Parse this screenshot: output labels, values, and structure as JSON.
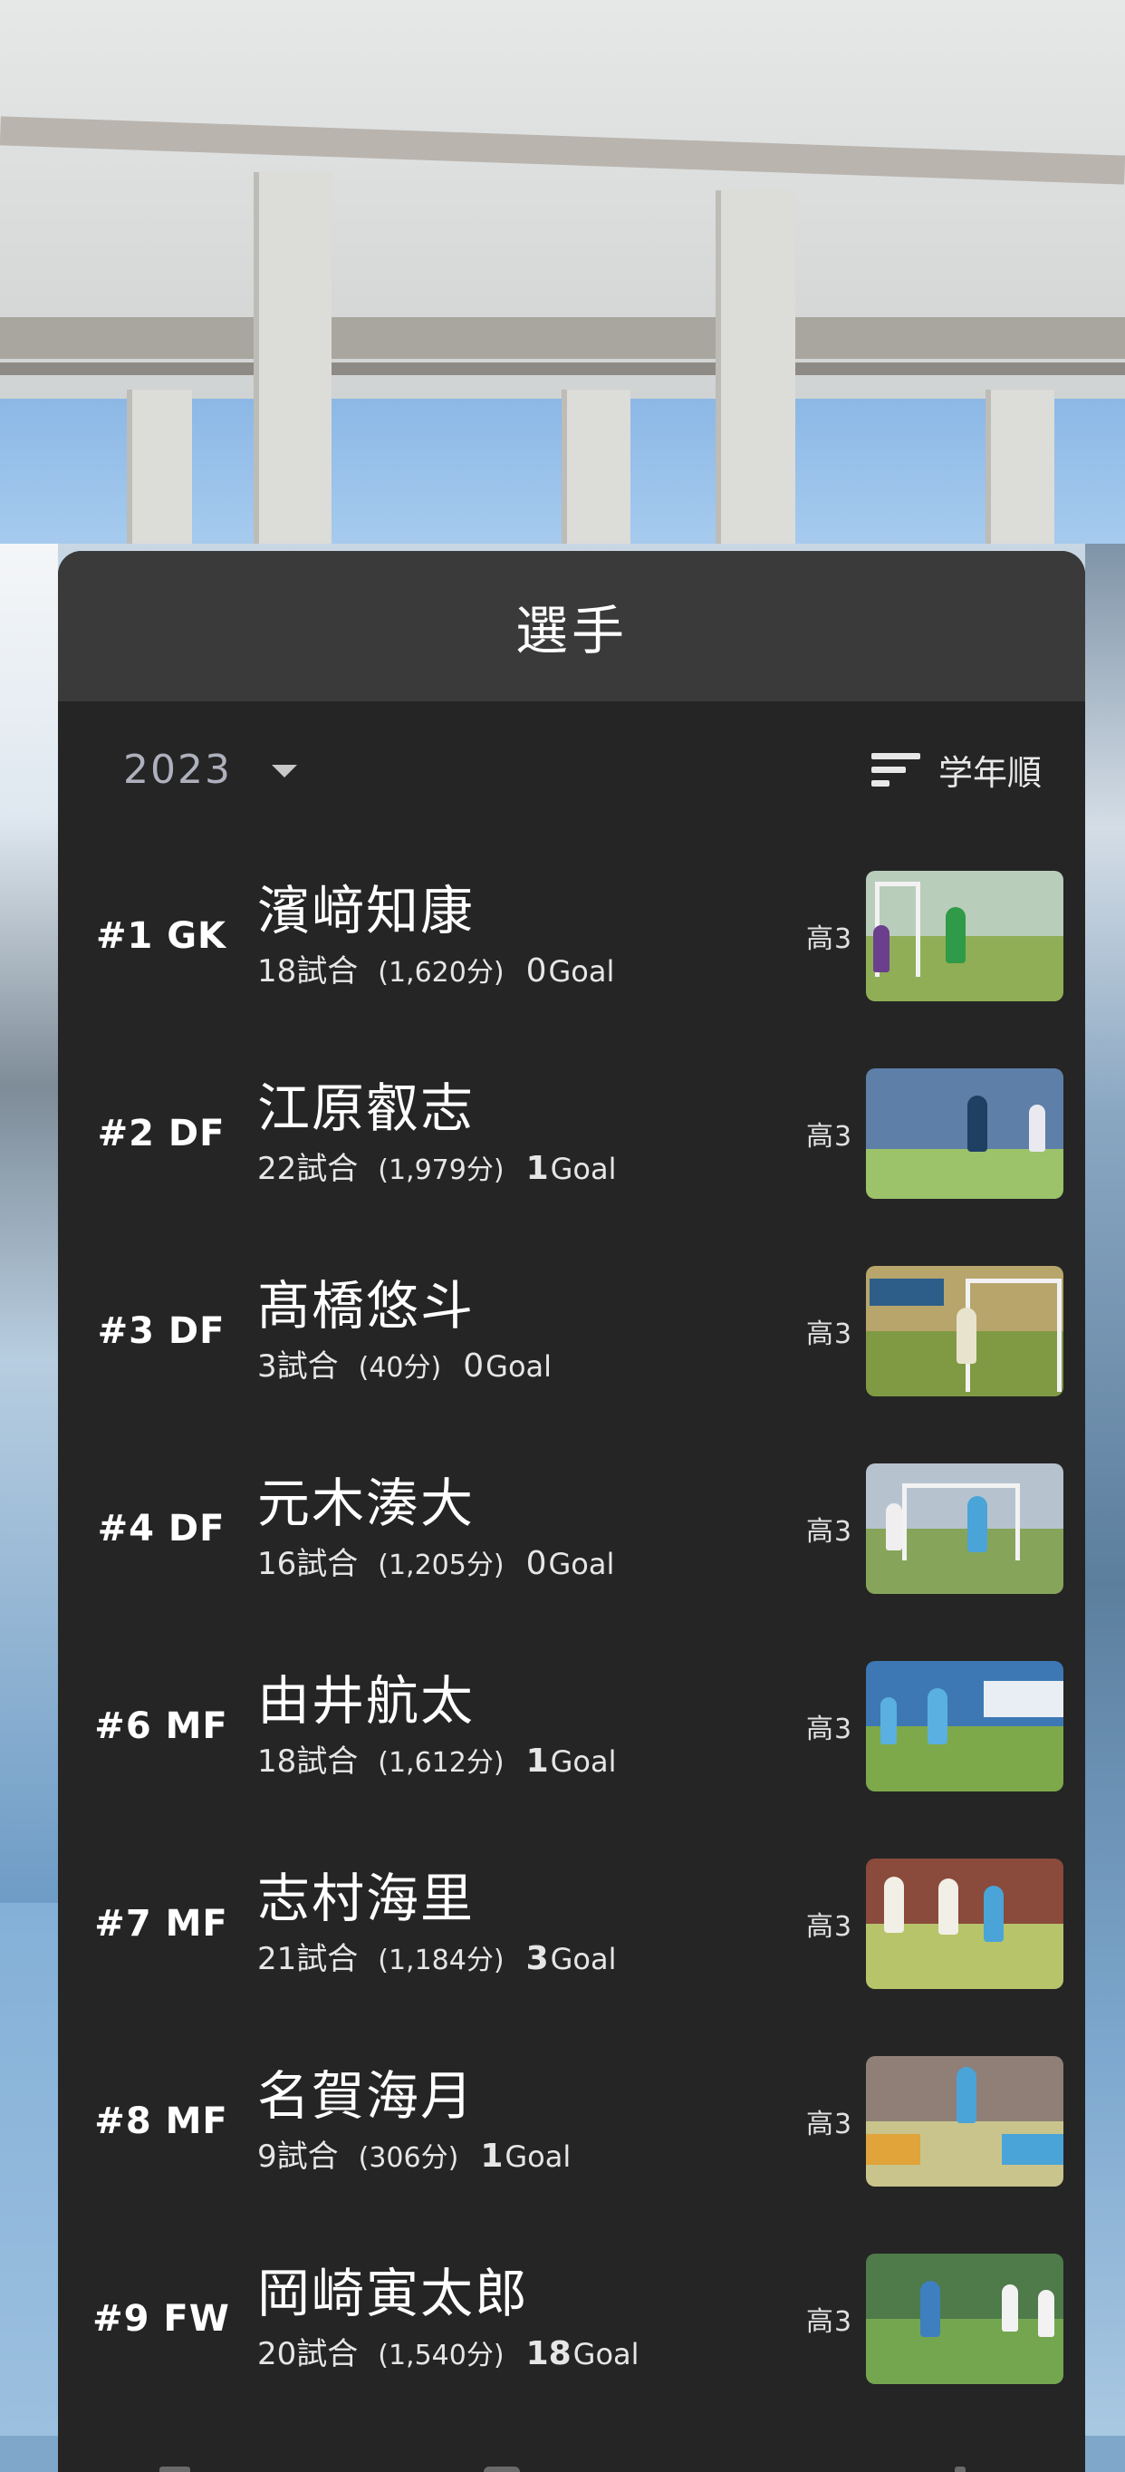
{
  "header": {
    "title": "選手"
  },
  "filter": {
    "year": "2023"
  },
  "sort": {
    "label": "学年順",
    "icon": "sort-icon"
  },
  "players": [
    {
      "number": "#1 GK",
      "name": "濱﨑知康",
      "games": "18試合",
      "minutes": "(1,620分)",
      "goals": "0",
      "goal_label": "Goal",
      "grade": "高3",
      "goals_bold": false
    },
    {
      "number": "#2 DF",
      "name": "江原叡志",
      "games": "22試合",
      "minutes": "(1,979分)",
      "goals": "1",
      "goal_label": "Goal",
      "grade": "高3",
      "goals_bold": true
    },
    {
      "number": "#3 DF",
      "name": "髙橋悠斗",
      "games": "3試合",
      "minutes": "(40分)",
      "goals": "0",
      "goal_label": "Goal",
      "grade": "高3",
      "goals_bold": false
    },
    {
      "number": "#4 DF",
      "name": "元木湊大",
      "games": "16試合",
      "minutes": "(1,205分)",
      "goals": "0",
      "goal_label": "Goal",
      "grade": "高3",
      "goals_bold": false
    },
    {
      "number": "#6 MF",
      "name": "由井航太",
      "games": "18試合",
      "minutes": "(1,612分)",
      "goals": "1",
      "goal_label": "Goal",
      "grade": "高3",
      "goals_bold": true
    },
    {
      "number": "#7 MF",
      "name": "志村海里",
      "games": "21試合",
      "minutes": "(1,184分)",
      "goals": "3",
      "goal_label": "Goal",
      "grade": "高3",
      "goals_bold": true
    },
    {
      "number": "#8 MF",
      "name": "名賀海月",
      "games": "9試合",
      "minutes": "(306分)",
      "goals": "1",
      "goal_label": "Goal",
      "grade": "高3",
      "goals_bold": true
    },
    {
      "number": "#9 FW",
      "name": "岡崎寅太郎",
      "games": "20試合",
      "minutes": "(1,540分)",
      "goals": "18",
      "goal_label": "Goal",
      "grade": "高3",
      "goals_bold": true
    }
  ],
  "colors": {
    "panel": "#252525",
    "header": "#3a3a3a",
    "year_text": "#aeb1bd",
    "text": "#ffffff"
  }
}
